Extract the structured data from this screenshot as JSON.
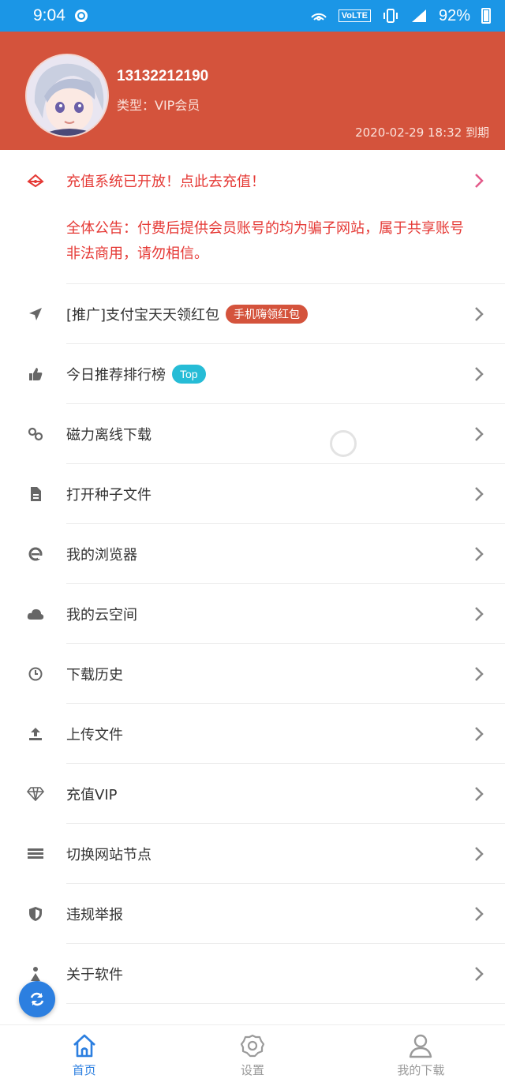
{
  "status_bar": {
    "time": "9:04",
    "network_badge": "VoLTE",
    "battery": "92%"
  },
  "profile": {
    "phone": "13132212190",
    "type_label": "类型：VIP会员",
    "expire": "2020-02-29 18:32 到期"
  },
  "announcements": {
    "recharge": "充值系统已开放！点此去充值！",
    "notice": "全体公告：付费后提供会员账号的均为骗子网站，属于共享账号非法商用，请勿相信。"
  },
  "menu": [
    {
      "label": "[推广]支付宝天天领红包",
      "badge": "手机嗨领红包",
      "badge_color": "#d4533c",
      "icon": "rocket-icon"
    },
    {
      "label": "今日推荐排行榜",
      "badge": "Top",
      "badge_color": "#26bcd6",
      "icon": "thumbs-up-icon"
    },
    {
      "label": "磁力离线下载",
      "icon": "link-icon"
    },
    {
      "label": "打开种子文件",
      "icon": "file-icon"
    },
    {
      "label": "我的浏览器",
      "icon": "browser-icon"
    },
    {
      "label": "我的云空间",
      "icon": "cloud-icon"
    },
    {
      "label": "下载历史",
      "icon": "clock-icon"
    },
    {
      "label": "上传文件",
      "icon": "upload-icon"
    },
    {
      "label": "充值VIP",
      "icon": "diamond-icon"
    },
    {
      "label": "切换网站节点",
      "icon": "server-icon"
    },
    {
      "label": "违规举报",
      "icon": "shield-icon"
    },
    {
      "label": "关于软件",
      "icon": "info-icon"
    }
  ],
  "bottom_nav": [
    {
      "label": "首页",
      "icon": "home-icon",
      "active": true
    },
    {
      "label": "设置",
      "icon": "gear-icon",
      "active": false
    },
    {
      "label": "我的下载",
      "icon": "user-icon",
      "active": false
    }
  ],
  "colors": {
    "status_bar": "#1b96e6",
    "header": "#d4533c",
    "alert_text": "#e53935",
    "active_nav": "#2c7fe0"
  }
}
